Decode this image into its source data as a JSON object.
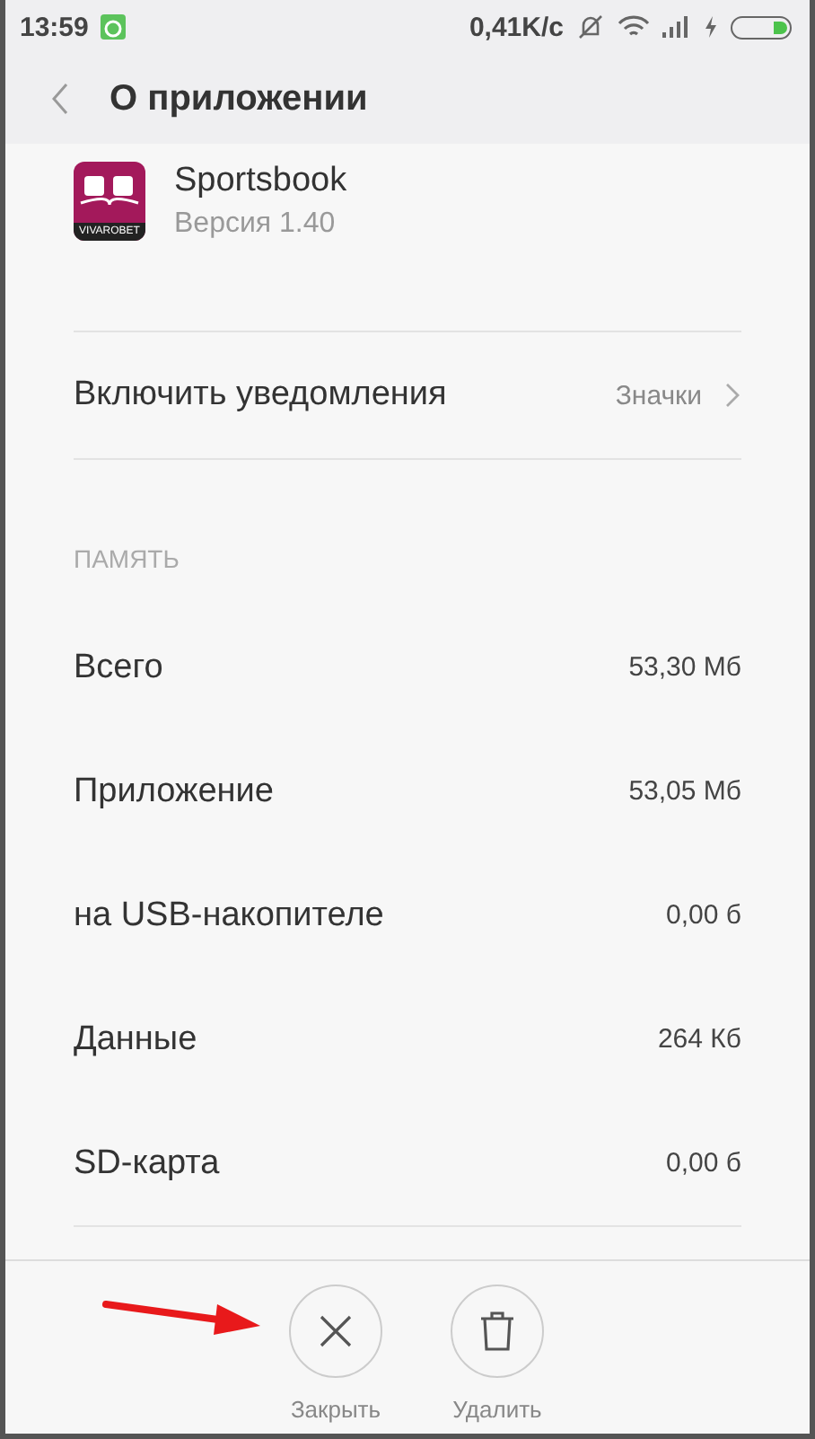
{
  "status_bar": {
    "time": "13:59",
    "speed": "0,41K/c"
  },
  "header": {
    "title": "О приложении"
  },
  "app": {
    "name": "Sportsbook",
    "version": "Версия 1.40",
    "icon_label": "VIVAROBET"
  },
  "notifications": {
    "label": "Включить уведомления",
    "value": "Значки"
  },
  "memory": {
    "title": "ПАМЯТЬ",
    "rows": [
      {
        "label": "Всего",
        "value": "53,30 Мб"
      },
      {
        "label": "Приложение",
        "value": "53,05 Мб"
      },
      {
        "label": "на USB-накопителе",
        "value": "0,00 б"
      },
      {
        "label": "Данные",
        "value": "264 Кб"
      },
      {
        "label": "SD-карта",
        "value": "0,00 б"
      }
    ]
  },
  "actions": [
    {
      "kind": "close",
      "label": "Закрыть"
    },
    {
      "kind": "delete",
      "label": "Удалить"
    }
  ]
}
